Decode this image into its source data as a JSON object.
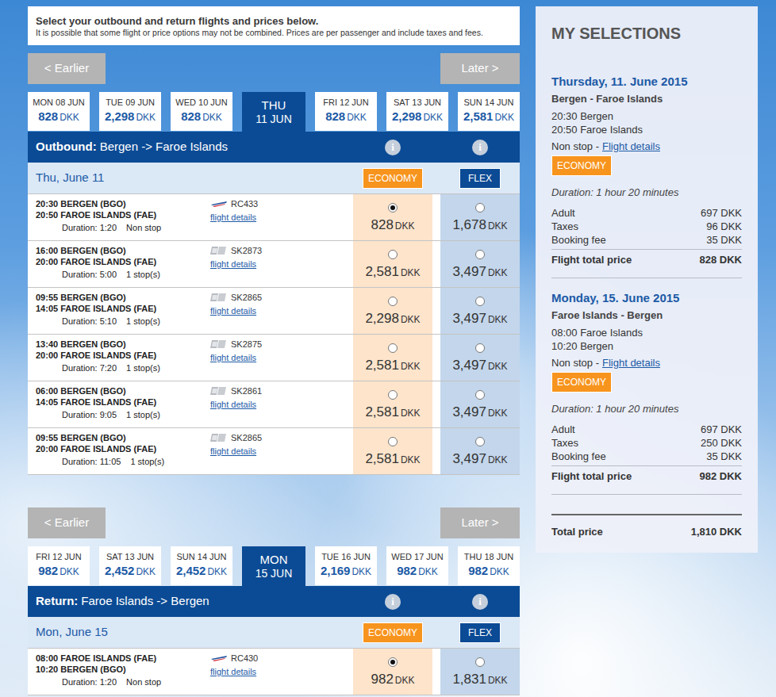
{
  "header": {
    "title": "Select your outbound and return flights and prices below.",
    "subtitle": "It is possible that some flight or price options may not be combined. Prices are per passenger and include taxes and fees."
  },
  "outbound": {
    "nav": {
      "earlier": "< Earlier",
      "later": "Later >"
    },
    "dates": [
      {
        "label": "MON 08 JUN",
        "price": "828",
        "currency": "DKK",
        "selected": false
      },
      {
        "label": "TUE 09 JUN",
        "price": "2,298",
        "currency": "DKK",
        "selected": false
      },
      {
        "label": "WED 10 JUN",
        "price": "828",
        "currency": "DKK",
        "selected": false
      },
      {
        "label": "THU",
        "sublabel": "11 JUN",
        "selected": true
      },
      {
        "label": "FRI 12 JUN",
        "price": "828",
        "currency": "DKK",
        "selected": false
      },
      {
        "label": "SAT 13 JUN",
        "price": "2,298",
        "currency": "DKK",
        "selected": false
      },
      {
        "label": "SUN 14 JUN",
        "price": "2,581",
        "currency": "DKK",
        "selected": false
      }
    ],
    "bar": {
      "label": "Outbound:",
      "route": "Bergen -> Faroe Islands",
      "info": [
        "i",
        "i"
      ]
    },
    "date_heading": "Thu, June 11",
    "fares": [
      "ECONOMY",
      "FLEX"
    ],
    "flights": [
      {
        "dep": "20:30 BERGEN (BGO)",
        "arr": "20:50 FAROE ISLANDS (FAE)",
        "duration": "Duration: 1:20",
        "stops": "Non stop",
        "kind": "rc",
        "flight": "RC433",
        "details": "flight details",
        "economy": {
          "price": "828",
          "currency": "DKK",
          "selected": true
        },
        "flex": {
          "price": "1,678",
          "currency": "DKK",
          "selected": false
        }
      },
      {
        "dep": "16:00 BERGEN (BGO)",
        "arr": "20:00 FAROE ISLANDS (FAE)",
        "duration": "Duration: 5:00",
        "stops": "1 stop(s)",
        "kind": "sk",
        "flight": "SK2873",
        "details": "flight details",
        "economy": {
          "price": "2,581",
          "currency": "DKK",
          "selected": false
        },
        "flex": {
          "price": "3,497",
          "currency": "DKK",
          "selected": false
        }
      },
      {
        "dep": "09:55 BERGEN (BGO)",
        "arr": "14:05 FAROE ISLANDS (FAE)",
        "duration": "Duration: 5:10",
        "stops": "1 stop(s)",
        "kind": "sk",
        "flight": "SK2865",
        "details": "flight details",
        "economy": {
          "price": "2,298",
          "currency": "DKK",
          "selected": false
        },
        "flex": {
          "price": "3,497",
          "currency": "DKK",
          "selected": false
        }
      },
      {
        "dep": "13:40 BERGEN (BGO)",
        "arr": "20:00 FAROE ISLANDS (FAE)",
        "duration": "Duration: 7:20",
        "stops": "1 stop(s)",
        "kind": "sk",
        "flight": "SK2875",
        "details": "flight details",
        "economy": {
          "price": "2,581",
          "currency": "DKK",
          "selected": false
        },
        "flex": {
          "price": "3,497",
          "currency": "DKK",
          "selected": false
        }
      },
      {
        "dep": "06:00 BERGEN (BGO)",
        "arr": "14:05 FAROE ISLANDS (FAE)",
        "duration": "Duration: 9:05",
        "stops": "1 stop(s)",
        "kind": "sk",
        "flight": "SK2861",
        "details": "flight details",
        "economy": {
          "price": "2,581",
          "currency": "DKK",
          "selected": false
        },
        "flex": {
          "price": "3,497",
          "currency": "DKK",
          "selected": false
        }
      },
      {
        "dep": "09:55 BERGEN (BGO)",
        "arr": "20:00 FAROE ISLANDS (FAE)",
        "duration": "Duration: 11:05",
        "stops": "1 stop(s)",
        "kind": "sk",
        "flight": "SK2865",
        "details": "flight details",
        "economy": {
          "price": "2,581",
          "currency": "DKK",
          "selected": false
        },
        "flex": {
          "price": "3,497",
          "currency": "DKK",
          "selected": false
        }
      }
    ]
  },
  "return": {
    "nav": {
      "earlier": "< Earlier",
      "later": "Later >"
    },
    "dates": [
      {
        "label": "FRI 12 JUN",
        "price": "982",
        "currency": "DKK",
        "selected": false
      },
      {
        "label": "SAT 13 JUN",
        "price": "2,452",
        "currency": "DKK",
        "selected": false
      },
      {
        "label": "SUN 14 JUN",
        "price": "2,452",
        "currency": "DKK",
        "selected": false
      },
      {
        "label": "MON",
        "sublabel": "15 JUN",
        "selected": true
      },
      {
        "label": "TUE 16 JUN",
        "price": "2,169",
        "currency": "DKK",
        "selected": false
      },
      {
        "label": "WED 17 JUN",
        "price": "982",
        "currency": "DKK",
        "selected": false
      },
      {
        "label": "THU 18 JUN",
        "price": "982",
        "currency": "DKK",
        "selected": false
      }
    ],
    "bar": {
      "label": "Return:",
      "route": "Faroe Islands -> Bergen",
      "info": [
        "i",
        "i"
      ]
    },
    "date_heading": "Mon, June 15",
    "fares": [
      "ECONOMY",
      "FLEX"
    ],
    "flights": [
      {
        "dep": "08:00 FAROE ISLANDS (FAE)",
        "arr": "10:20 BERGEN (BGO)",
        "duration": "Duration: 1:20",
        "stops": "Non stop",
        "kind": "rc",
        "flight": "RC430",
        "details": "flight details",
        "economy": {
          "price": "982",
          "currency": "DKK",
          "selected": true
        },
        "flex": {
          "price": "1,831",
          "currency": "DKK",
          "selected": false
        }
      }
    ]
  },
  "selections": {
    "title": "MY SELECTIONS",
    "legs": [
      {
        "date": "Thursday, 11. June 2015",
        "route": "Bergen - Faroe Islands",
        "dep": "20:30 Bergen",
        "arr": "20:50 Faroe Islands",
        "stops": "Non stop -",
        "details": "Flight details",
        "fare": "ECONOMY",
        "duration": "Duration: 1 hour 20 minutes",
        "lines": [
          {
            "label": "Adult",
            "value": "697 DKK"
          },
          {
            "label": "Taxes",
            "value": "96 DKK"
          },
          {
            "label": "Booking fee",
            "value": "35 DKK"
          }
        ],
        "total": {
          "label": "Flight total price",
          "value": "828 DKK"
        }
      },
      {
        "date": "Monday, 15. June 2015",
        "route": "Faroe Islands - Bergen",
        "dep": "08:00 Faroe Islands",
        "arr": "10:20 Bergen",
        "stops": "Non stop -",
        "details": "Flight details",
        "fare": "ECONOMY",
        "duration": "Duration: 1 hour 20 minutes",
        "lines": [
          {
            "label": "Adult",
            "value": "697 DKK"
          },
          {
            "label": "Taxes",
            "value": "250 DKK"
          },
          {
            "label": "Booking fee",
            "value": "35 DKK"
          }
        ],
        "total": {
          "label": "Flight total price",
          "value": "982 DKK"
        }
      }
    ],
    "total": {
      "label": "Total price",
      "value": "1,810 DKK"
    }
  }
}
